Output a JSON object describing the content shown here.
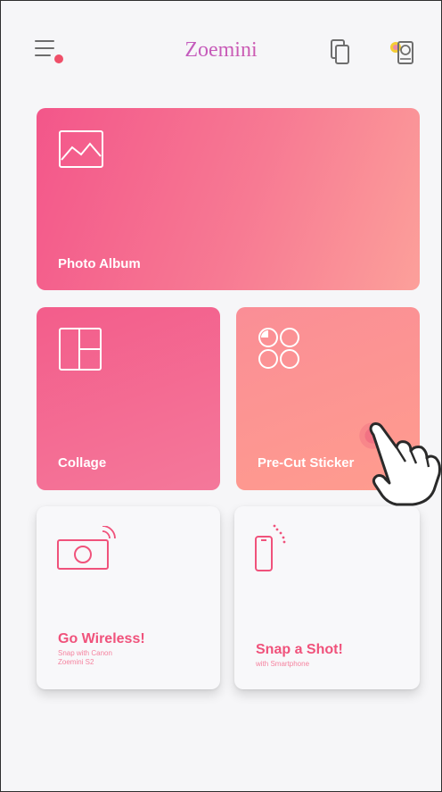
{
  "app": {
    "title": "Zoemini"
  },
  "header": {
    "menu_icon": "hamburger-menu-icon",
    "right_icons": [
      "copies-icon",
      "printer-connection-icon"
    ]
  },
  "cards": {
    "photo_album": {
      "label": "Photo Album",
      "icon": "image-icon"
    },
    "collage": {
      "label": "Collage",
      "icon": "collage-layout-icon"
    },
    "pre_cut_sticker": {
      "label": "Pre-Cut Sticker",
      "icon": "sticker-circles-icon"
    },
    "go_wireless": {
      "title": "Go Wireless!",
      "subtitle_line1": "Snap with Canon",
      "subtitle_line2": "Zoemini S2",
      "icon": "wireless-camera-icon"
    },
    "snap_a_shot": {
      "title": "Snap a Shot!",
      "subtitle": "with Smartphone",
      "icon": "smartphone-signal-icon"
    }
  },
  "colors": {
    "accent_pink": "#f0527b",
    "album_gradient": [
      "#f3568a",
      "#fca09a"
    ],
    "collage": "#f35d8b",
    "sticker": "#fa8e96",
    "background": "#f6f6f8"
  }
}
